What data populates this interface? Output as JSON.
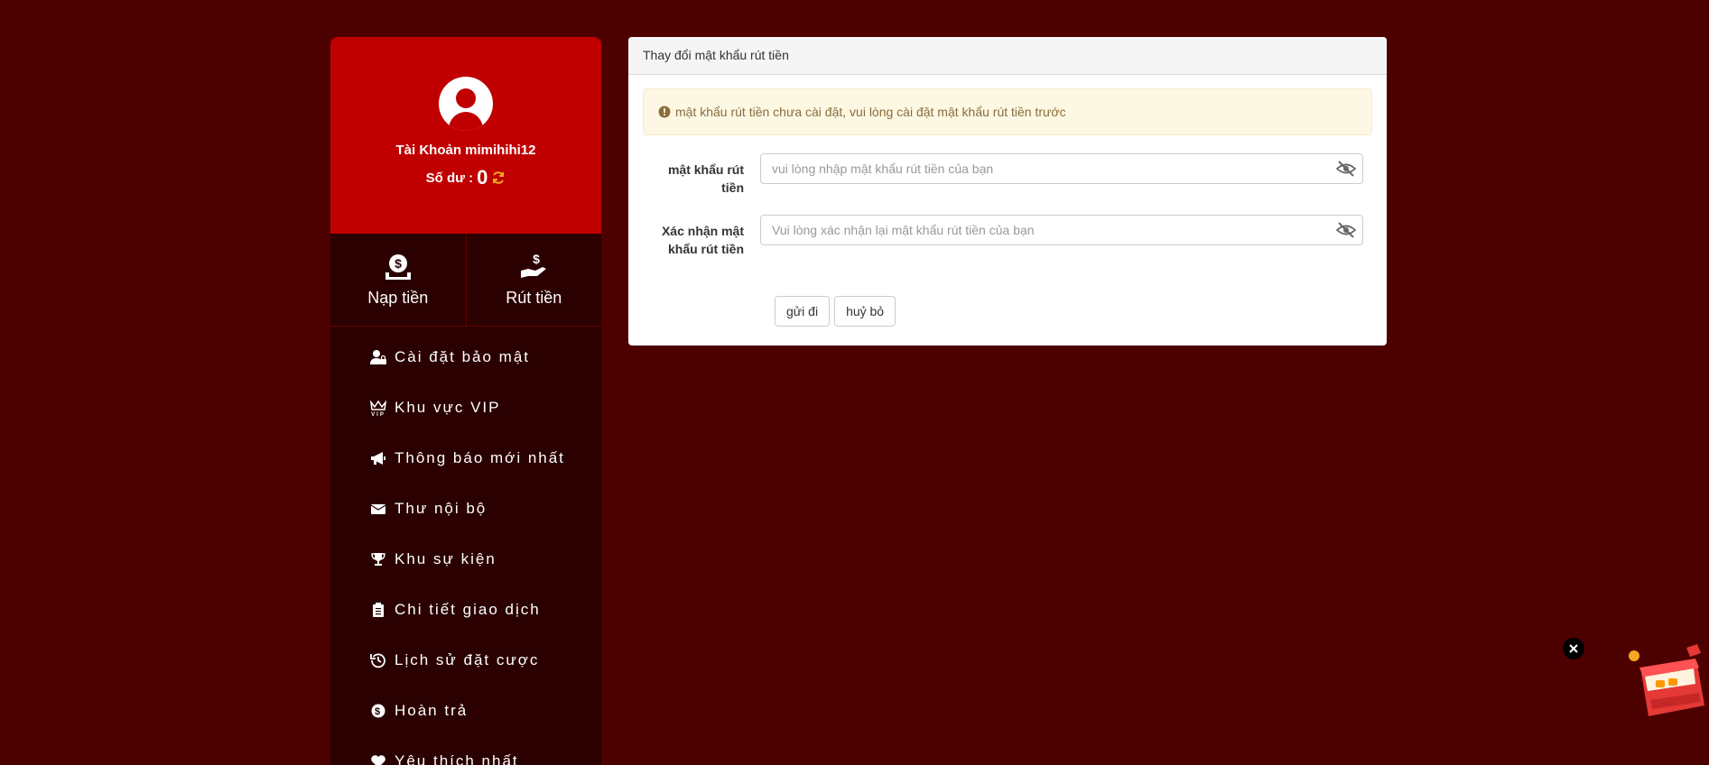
{
  "sidebar": {
    "account_label": "Tài Khoản mimihihi12",
    "balance_label": "Số dư :",
    "balance_value": "0",
    "deposit_label": "Nạp tiền",
    "withdraw_label": "Rút tiền",
    "menu": [
      {
        "label": "Cài đặt bảo mật",
        "icon": "user-lock-icon"
      },
      {
        "label": "Khu vực VIP",
        "icon": "vip-crown-icon"
      },
      {
        "label": "Thông báo mới nhất",
        "icon": "megaphone-icon"
      },
      {
        "label": "Thư nội bộ",
        "icon": "envelope-icon"
      },
      {
        "label": "Khu sự kiện",
        "icon": "trophy-icon"
      },
      {
        "label": "Chi tiết giao dịch",
        "icon": "clipboard-icon"
      },
      {
        "label": "Lịch sử đặt cược",
        "icon": "history-icon"
      },
      {
        "label": "Hoàn trả",
        "icon": "dollar-circle-icon"
      },
      {
        "label": "Yêu thích nhất",
        "icon": "heart-icon"
      }
    ]
  },
  "panel": {
    "title": "Thay đổi mật khẩu rút tiền",
    "alert": "mật khẩu rút tiền chưa cài đặt, vui lòng cài đặt mật khẩu rút tiền trước",
    "password_label": "mật khẩu rút tiền",
    "password_placeholder": "vui lòng nhập mật khẩu rút tiền của bạn",
    "confirm_label": "Xác nhận mật khẩu rút tiền",
    "confirm_placeholder": "Vui lòng xác nhận lại mật khẩu rút tiền của bạn",
    "submit_label": "gửi đi",
    "cancel_label": "huỷ bỏ"
  },
  "colors": {
    "background": "#4d0000",
    "profile": "#c00000",
    "sidebar": "#2a0000",
    "refresh": "#f5a623"
  }
}
